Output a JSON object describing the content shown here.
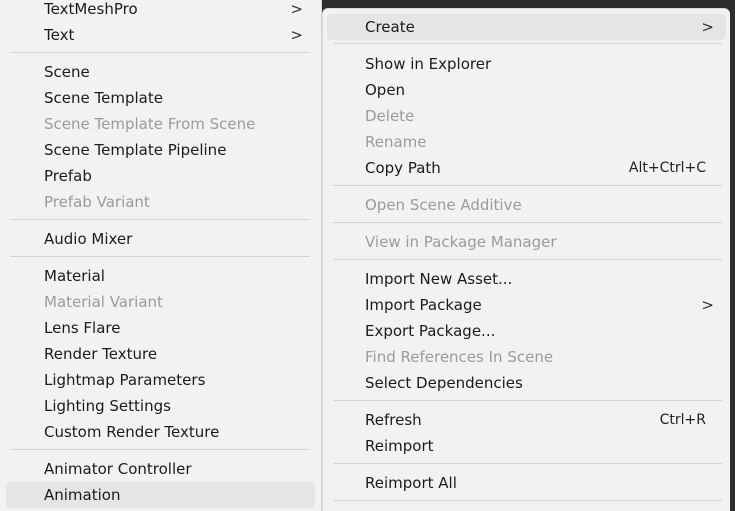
{
  "left_menu": {
    "items": [
      {
        "label": "TextMeshPro",
        "submenu": ">",
        "disabled": false
      },
      {
        "label": "Text",
        "submenu": ">",
        "disabled": false
      },
      {
        "label": "Scene",
        "disabled": false
      },
      {
        "label": "Scene Template",
        "disabled": false
      },
      {
        "label": "Scene Template From Scene",
        "disabled": true
      },
      {
        "label": "Scene Template Pipeline",
        "disabled": false
      },
      {
        "label": "Prefab",
        "disabled": false
      },
      {
        "label": "Prefab Variant",
        "disabled": true
      },
      {
        "label": "Audio Mixer",
        "disabled": false
      },
      {
        "label": "Material",
        "disabled": false
      },
      {
        "label": "Material Variant",
        "disabled": true
      },
      {
        "label": "Lens Flare",
        "disabled": false
      },
      {
        "label": "Render Texture",
        "disabled": false
      },
      {
        "label": "Lightmap Parameters",
        "disabled": false
      },
      {
        "label": "Lighting Settings",
        "disabled": false
      },
      {
        "label": "Custom Render Texture",
        "disabled": false
      },
      {
        "label": "Animator Controller",
        "disabled": false
      },
      {
        "label": "Animation",
        "disabled": false,
        "highlighted": true
      }
    ]
  },
  "right_menu": {
    "items": [
      {
        "label": "Create",
        "submenu": ">",
        "disabled": false,
        "highlighted": true
      },
      {
        "label": "Show in Explorer",
        "disabled": false
      },
      {
        "label": "Open",
        "disabled": false
      },
      {
        "label": "Delete",
        "disabled": true
      },
      {
        "label": "Rename",
        "disabled": true
      },
      {
        "label": "Copy Path",
        "shortcut": "Alt+Ctrl+C",
        "disabled": false
      },
      {
        "label": "Open Scene Additive",
        "disabled": true
      },
      {
        "label": "View in Package Manager",
        "disabled": true
      },
      {
        "label": "Import New Asset...",
        "disabled": false
      },
      {
        "label": "Import Package",
        "submenu": ">",
        "disabled": false
      },
      {
        "label": "Export Package...",
        "disabled": false
      },
      {
        "label": "Find References In Scene",
        "disabled": true
      },
      {
        "label": "Select Dependencies",
        "disabled": false
      },
      {
        "label": "Refresh",
        "shortcut": "Ctrl+R",
        "disabled": false
      },
      {
        "label": "Reimport",
        "disabled": false
      },
      {
        "label": "Reimport All",
        "disabled": false
      }
    ]
  },
  "colors": {
    "menu_background": "#f2f2f2",
    "highlight": "#e5e5e5",
    "text": "#1b1b1b",
    "disabled_text": "#9b9b9b",
    "separator": "#d2d2d2",
    "backdrop": "#2d2d2d"
  }
}
